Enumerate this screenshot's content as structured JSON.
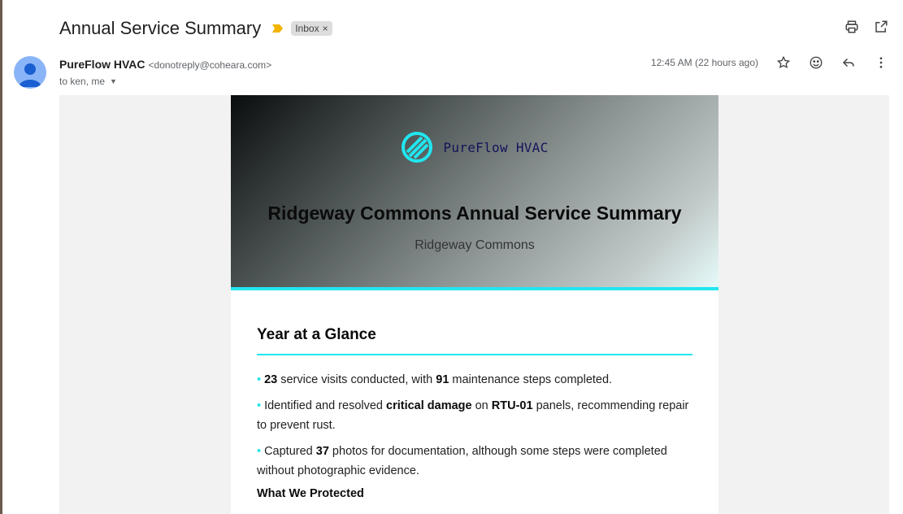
{
  "subject": "Annual Service Summary",
  "label": "Inbox",
  "label_remove": "×",
  "sender": {
    "name": "PureFlow HVAC",
    "email": "<donotreply@coheara.com>",
    "to": "to ken, me",
    "timestamp": "12:45 AM (22 hours ago)"
  },
  "toolbar_icons": [
    "print-icon",
    "open-in-new-icon",
    "star-icon",
    "emoji-icon",
    "reply-icon",
    "more-vert-icon"
  ],
  "email": {
    "logo_text": "PureFlow HVAC",
    "title": "Ridgeway Commons Annual Service Summary",
    "subtitle": "Ridgeway Commons",
    "section_title": "Year at a Glance",
    "bullets": [
      {
        "parts": [
          {
            "t": "23",
            "b": true
          },
          {
            "t": " service visits conducted, with ",
            "b": false
          },
          {
            "t": "91",
            "b": true
          },
          {
            "t": " maintenance steps completed.",
            "b": false
          }
        ]
      },
      {
        "parts": [
          {
            "t": "Identified and resolved ",
            "b": false
          },
          {
            "t": "critical damage",
            "b": true
          },
          {
            "t": " on ",
            "b": false
          },
          {
            "t": "RTU-01",
            "b": true
          },
          {
            "t": " panels, recommending repair to prevent rust.",
            "b": false
          }
        ]
      },
      {
        "parts": [
          {
            "t": "Captured ",
            "b": false
          },
          {
            "t": "37",
            "b": true
          },
          {
            "t": " photos for documentation, although some steps were completed without photographic evidence.",
            "b": false
          }
        ]
      }
    ],
    "sub_title": "What We Protected"
  },
  "colors": {
    "accent": "#21e6ef",
    "importance": "#f4b400",
    "avatar": "#8ab4f8"
  }
}
